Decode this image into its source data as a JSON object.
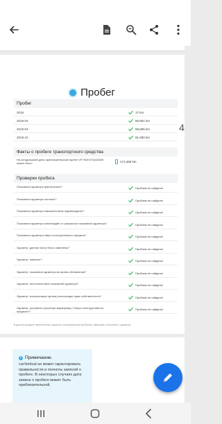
{
  "toolbar": {
    "icons": [
      "back-arrow-icon",
      "document-icon",
      "zoom-icon",
      "share-icon",
      "more-icon"
    ]
  },
  "report": {
    "title": "Пробег",
    "mileage_section": {
      "header": "Пробег",
      "rows": [
        {
          "date": "2018",
          "value": "17 km"
        },
        {
          "date": "2019-03",
          "value": "50,901 km"
        },
        {
          "date": "2019-04",
          "value": "58,685 km"
        },
        {
          "date": "2019-10",
          "value": "91,090 km"
        }
      ]
    },
    "facts_section": {
      "header": "Факты о пробеге транспортного средства",
      "label": "На сегодняшний день приблизительный пробег VF7SDKH7QG8309 может быть:",
      "value": "171,485 km"
    },
    "checks_section": {
      "header": "Проверки пробега",
      "rows": [
        {
          "label": "Показания одометра фактические?",
          "value": "Проблем не найдено!"
        },
        {
          "label": "Показания одометра честные?",
          "value": "Проблем не найдено!"
        },
        {
          "label": "Показания одометра замошенством подтверждено?",
          "value": "Проблем не найдено!"
        },
        {
          "label": "Показания одометра освобождён от раскрытых показаний одометра?",
          "value": "Проблем не найдено!"
        },
        {
          "label": "Показания одометра сверх конструктивного предела?",
          "value": "Проблем не найдено!"
        },
        {
          "label": "Одометр: данные могут быть изменены?",
          "value": "Проблем не найдено!"
        },
        {
          "label": "Одометр: заменен?",
          "value": "Проблем не найдено!"
        },
        {
          "label": "Одометр: показания одометра во время обновления?",
          "value": "Проблем не найдено!"
        },
        {
          "label": "Одометр: несоответствие показаний одометра?",
          "value": "Проблем не найдено!"
        },
        {
          "label": "Одометр: консультация органа регистрации прав собственности?",
          "value": "Проблем не найдено!"
        },
        {
          "label": "Одометр: устранить проченую маркировку «Сверх конструктивного предела»?",
          "value": "Проблем не найдено!"
        }
      ]
    },
    "footnote": "В данном разделе перечислены сокрытые потенциальные проблемы, имеющие отношение к одометру.",
    "page_number": "4"
  },
  "note": {
    "title": "Примечание.",
    "text": "carVertical не может гарантировать правильности и полноты записей о пробеге. В некоторых случаях дата записи о пробеге может быть приблизительной."
  },
  "colors": {
    "accent": "#1a73e8",
    "info": "#39a9e0",
    "check": "#3db66b",
    "note_bg": "#e7f5fd"
  }
}
